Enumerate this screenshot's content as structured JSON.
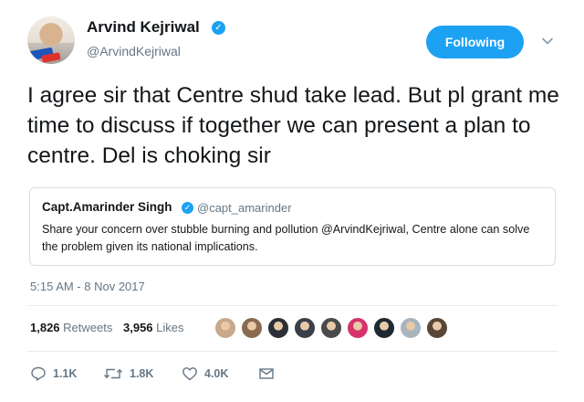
{
  "author": {
    "name": "Arvind Kejriwal",
    "handle": "@ArvindKejriwal"
  },
  "follow_button": {
    "label": "Following"
  },
  "tweet": {
    "text": "I agree sir that Centre shud take lead. But pl grant me time to discuss if together we can present a plan to centre. Del is choking sir",
    "timestamp": "5:15 AM - 8 Nov 2017"
  },
  "quoted_tweet": {
    "name": "Capt.Amarinder Singh",
    "handle": "@capt_amarinder",
    "text": "Share your concern over stubble burning and pollution @ArvindKejriwal, Centre alone can solve the problem given its national implications."
  },
  "stats": {
    "retweets_count": "1,826",
    "retweets_label": "Retweets",
    "likes_count": "3,956",
    "likes_label": "Likes"
  },
  "likers": [
    {
      "icon": "avatar",
      "color": "#c8a98a"
    },
    {
      "icon": "avatar",
      "color": "#8a6b4f"
    },
    {
      "icon": "avatar",
      "color": "#2b2f36"
    },
    {
      "icon": "avatar",
      "color": "#3a3f48"
    },
    {
      "icon": "avatar",
      "color": "#4a4a4a"
    },
    {
      "icon": "avatar",
      "color": "#d6336c"
    },
    {
      "icon": "avatar",
      "color": "#1e2a33"
    },
    {
      "icon": "avatar",
      "color": "#a9b4bd"
    },
    {
      "icon": "avatar",
      "color": "#5a4636"
    }
  ],
  "actions": {
    "replies": "1.1K",
    "retweets": "1.8K",
    "likes": "4.0K"
  },
  "colors": {
    "accent": "#1da1f2",
    "muted": "#657786",
    "border": "#e6ecf0"
  }
}
